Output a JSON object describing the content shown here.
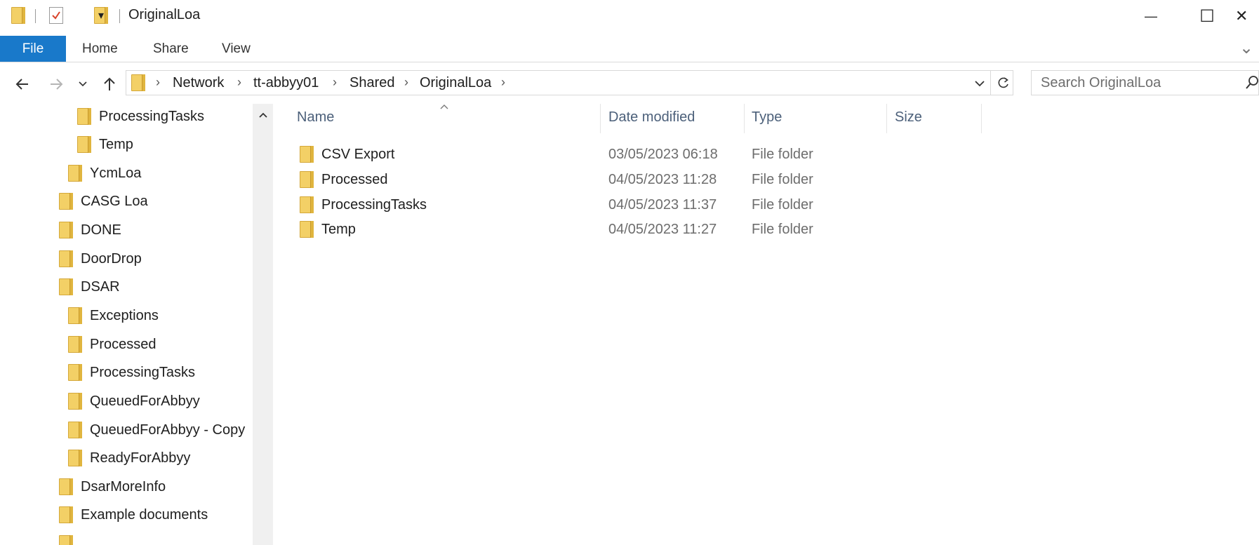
{
  "window": {
    "title": "OriginalLoa",
    "qat_dropdown": "▾",
    "controls": {
      "minimize": "—",
      "maximize": "☐",
      "close": "✕"
    }
  },
  "ribbon": {
    "tabs": [
      {
        "label": "File"
      },
      {
        "label": "Home"
      },
      {
        "label": "Share"
      },
      {
        "label": "View"
      }
    ],
    "expand_glyph": "⌄"
  },
  "address_bar": {
    "breadcrumbs": [
      "Network",
      "tt-abbyy01",
      "Shared",
      "OriginalLoa"
    ],
    "separator": "›"
  },
  "search": {
    "placeholder": "Search OriginalLoa"
  },
  "nav_tree": [
    {
      "label": "ProcessingTasks"
    },
    {
      "label": "Temp"
    },
    {
      "label": "YcmLoa"
    },
    {
      "label": "CASG Loa"
    },
    {
      "label": "DONE"
    },
    {
      "label": "DoorDrop"
    },
    {
      "label": "DSAR"
    },
    {
      "label": "Exceptions"
    },
    {
      "label": "Processed"
    },
    {
      "label": "ProcessingTasks"
    },
    {
      "label": "QueuedForAbbyy"
    },
    {
      "label": "QueuedForAbbyy - Copy"
    },
    {
      "label": "ReadyForAbbyy"
    },
    {
      "label": "DsarMoreInfo"
    },
    {
      "label": "Example documents"
    }
  ],
  "columns": {
    "name": "Name",
    "date_modified": "Date modified",
    "type": "Type",
    "size": "Size"
  },
  "files": [
    {
      "name": "CSV Export",
      "date": "03/05/2023 06:18",
      "type": "File folder"
    },
    {
      "name": "Processed",
      "date": "04/05/2023 11:28",
      "type": "File folder"
    },
    {
      "name": "ProcessingTasks",
      "date": "04/05/2023 11:37",
      "type": "File folder"
    },
    {
      "name": "Temp",
      "date": "04/05/2023 11:27",
      "type": "File folder"
    }
  ],
  "colors": {
    "file_tab": "#1979ca",
    "column_header": "#4c607a",
    "folder": "#f3d066"
  }
}
